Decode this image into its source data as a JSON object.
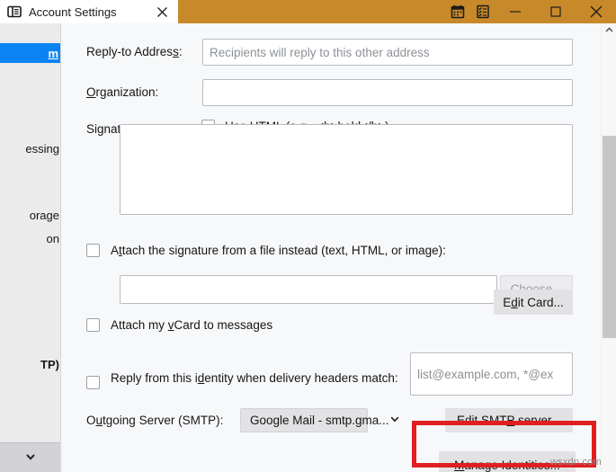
{
  "window": {
    "tab_title": "Account Settings",
    "tab_icon": "account-settings-icon",
    "close_tab_icon": "close-icon",
    "titlebar_color": "#c8892a",
    "calendar_icon": "calendar-icon",
    "tasks_icon": "tasks-icon",
    "minimize_icon": "minimize-icon",
    "maximize_icon": "maximize-icon",
    "close_icon": "close-icon"
  },
  "sidebar": {
    "accent_color": "#0b84f3",
    "items": [
      {
        "label": "m",
        "selected": true,
        "bold": true
      },
      {
        "label": "essing",
        "selected": false,
        "bold": false
      },
      {
        "label": "orage",
        "selected": false,
        "bold": false
      },
      {
        "label": "on",
        "selected": false,
        "bold": false
      },
      {
        "label": "TP)",
        "selected": false,
        "bold": true
      }
    ],
    "expand_icon": "chevron-down-icon"
  },
  "form": {
    "reply_to": {
      "label": "Reply-to Address:",
      "accel": "s",
      "value": "",
      "placeholder": "Recipients will reply to this other address"
    },
    "organization": {
      "label": "Organization:",
      "accel": "O",
      "value": "",
      "placeholder": ""
    },
    "signature_text": {
      "label": "Signature text:",
      "accel": "x",
      "value": ""
    },
    "use_html": {
      "label": "Use HTML (e.g., <b>bold</b>)",
      "accel": "L",
      "checked": false
    },
    "attach_signature_file": {
      "label": "Attach the signature from a file instead (text, HTML, or image):",
      "accel": "t",
      "checked": false,
      "path_value": "",
      "choose_button": "Choose...",
      "choose_accel": "C",
      "choose_disabled": true
    },
    "attach_vcard": {
      "label": "Attach my vCard to messages",
      "accel": "v",
      "checked": false,
      "edit_button": "Edit Card...",
      "edit_accel": "d"
    },
    "reply_from_identity": {
      "label_line1": "Reply from this identity when delivery headers",
      "label_line2": "match:",
      "accel": "d",
      "checked": false,
      "value": "",
      "placeholder": "list@example.com, *@ex"
    },
    "outgoing_server": {
      "label": "Outgoing Server (SMTP):",
      "accel": "u",
      "selected_option": "Google Mail - smtp.gma...",
      "dropdown_icon": "chevron-down-icon",
      "edit_button": "Edit SMTP server...",
      "edit_accel": "P"
    },
    "manage_identities": {
      "label": "Manage Identities...",
      "accel": "M"
    }
  },
  "scrollbar": {
    "up_arrow_icon": "chevron-up-icon"
  },
  "annotation": {
    "color": "#e02020",
    "watermark": "wsxdn.com"
  }
}
